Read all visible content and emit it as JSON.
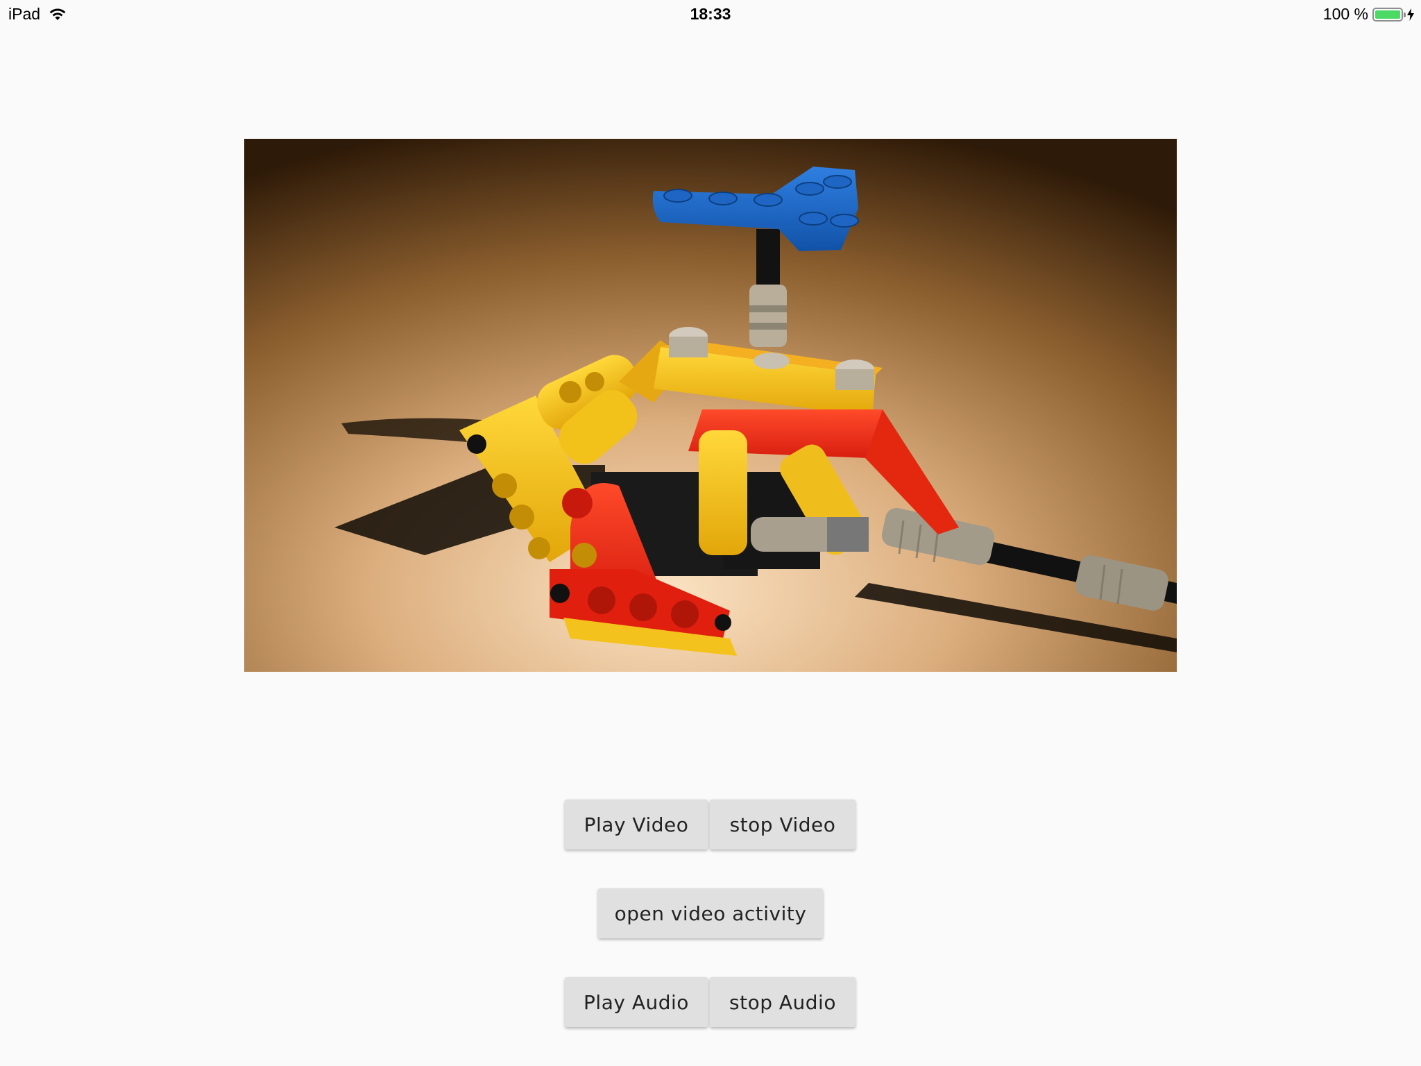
{
  "status_bar": {
    "device": "iPad",
    "time": "18:33",
    "battery": "100 %",
    "wifi_icon": "wifi-icon",
    "battery_icon": "battery-icon",
    "charging_icon": "lightning-bolt-icon",
    "battery_color": "#4cd964"
  },
  "video": {
    "content": "video-frame"
  },
  "buttons": {
    "play_video": "Play Video",
    "stop_video": "stop Video",
    "open_video_activity": "open video activity",
    "play_audio": "Play Audio",
    "stop_audio": "stop Audio"
  }
}
